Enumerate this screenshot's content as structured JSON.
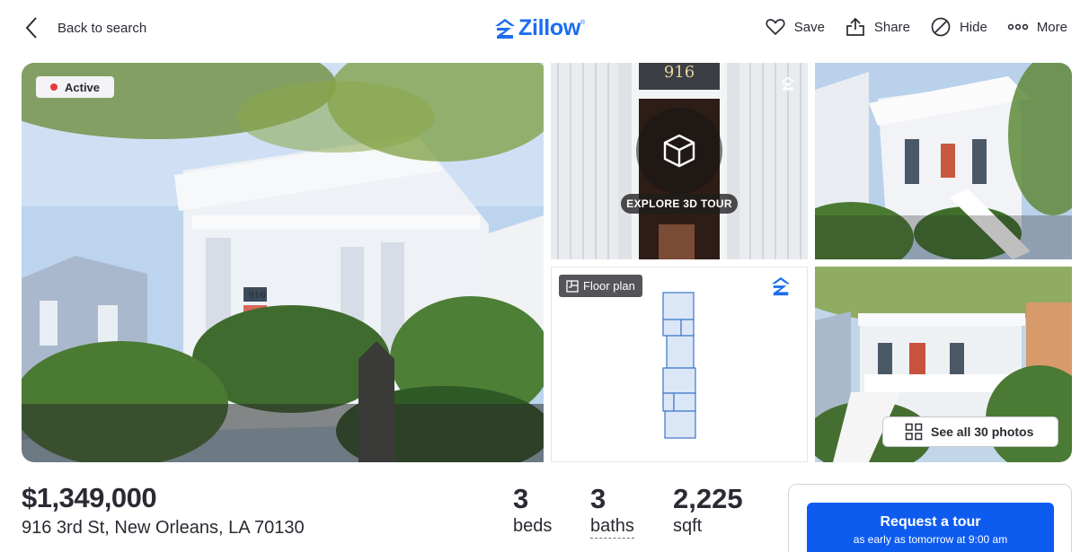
{
  "header": {
    "back_label": "Back to search",
    "logo_text": "Zillow",
    "logo_mark": "®",
    "actions": {
      "save": "Save",
      "share": "Share",
      "hide": "Hide",
      "more": "More"
    }
  },
  "gallery": {
    "status": "Active",
    "tour_label": "EXPLORE 3D TOUR",
    "floor_plan_label": "Floor plan",
    "see_all_label": "See all 30 photos",
    "house_number": "916"
  },
  "listing": {
    "price": "$1,349,000",
    "address": "916 3rd St, New Orleans, LA 70130",
    "beds_value": "3",
    "beds_unit": "beds",
    "baths_value": "3",
    "baths_unit": "baths",
    "sqft_value": "2,225",
    "sqft_unit": "sqft"
  },
  "tour_card": {
    "title": "Request a tour",
    "subtitle": "as early as tomorrow at 9:00 am"
  },
  "colors": {
    "brand_blue": "#1c6df2",
    "button_blue": "#0e5bf0",
    "status_red": "#e8373d"
  },
  "icons": [
    "chevron-left-icon",
    "zillow-logo-icon",
    "heart-icon",
    "share-icon",
    "hide-icon",
    "more-icon",
    "cube-3d-icon",
    "floor-plan-icon",
    "grid-icon"
  ]
}
